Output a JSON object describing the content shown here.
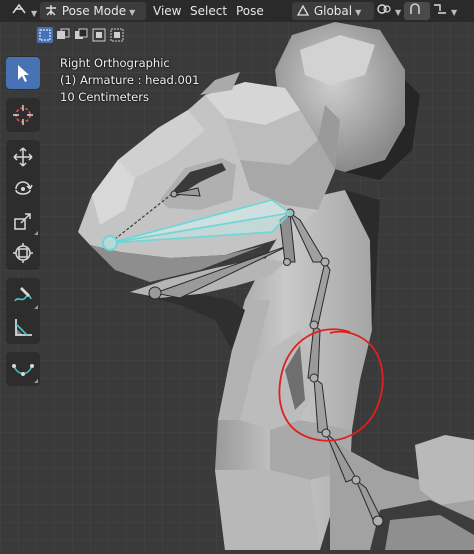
{
  "header": {
    "mode_label": "Pose Mode",
    "menus": [
      "View",
      "Select",
      "Pose"
    ],
    "transform_orientation": "Global"
  },
  "viewport": {
    "view_name": "Right Orthographic",
    "selection_info": "(1) Armature : head.001",
    "scale_info": "10 Centimeters"
  },
  "toolbar": {
    "tools": [
      "select-box",
      "cursor",
      "move",
      "rotate",
      "scale",
      "transform",
      "annotate",
      "measure",
      "pose-tweak"
    ],
    "active_tool": "select-box"
  },
  "colors": {
    "header_bg": "#2a2a2a",
    "viewport_bg": "#3a3a3a",
    "grid_line": "#454545",
    "mesh_light": "#c8c8c8",
    "mesh_dark": "#2b2b2b",
    "active_bone": "#6fd6d6",
    "bone_gray": "#8a8a8a",
    "annotation_red": "#e02020",
    "active_tool_bg": "#4772b3"
  }
}
